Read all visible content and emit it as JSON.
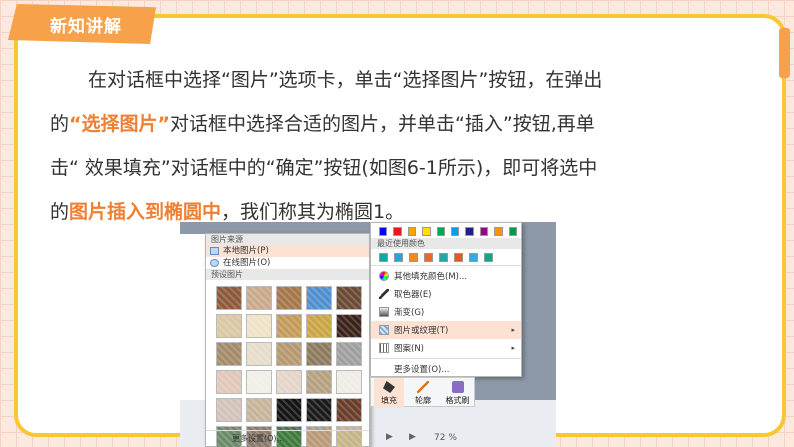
{
  "badge": {
    "label": "新知讲解"
  },
  "paragraph": {
    "l1": "在对话框中选择“图片”选项卡，单击“选择图片”按钮，在弹出",
    "l2_a": "的",
    "l2_hl": "“选择图片”",
    "l2_b": "对话框中选择合适的图片，并单击“插入”按钮,再单",
    "l3": "击“ 效果填充”对话框中的“确定”按钮(如图6-1所示)，即可将选中",
    "l4_a": "的",
    "l4_hl": "图片插入到椭圆中",
    "l4_b": "，我们称其为椭圆1。"
  },
  "picture_menu": {
    "source_header": "图片来源",
    "local": "本地图片(P)",
    "online": "在线图片(O)",
    "preset_header": "预设图片",
    "more": "更多设置(O)..."
  },
  "color_menu": {
    "recent_header": "最近使用颜色",
    "items": {
      "other_fill": "其他填充颜色(M)...",
      "eyedropper": "取色器(E)",
      "gradient": "渐变(G)",
      "picture_texture": "图片或纹理(T)",
      "pattern": "图案(N)",
      "more": "更多设置(O)..."
    }
  },
  "toolbar": {
    "fill": "填充",
    "outline": "轮廓",
    "format_painter": "格式刷"
  },
  "status": {
    "zoom": "72 %"
  },
  "colors": {
    "accent": "#f7a24a",
    "border": "#f9c731",
    "highlight": "#ef7f33",
    "theme_row": [
      "#0000ff",
      "#e61b1b",
      "#f7a600",
      "#ffde00",
      "#00a650",
      "#00a0e9",
      "#1d2088",
      "#920783",
      "#f39800",
      "#009944"
    ],
    "recent_row": [
      "#1aa3a6",
      "#29a3d6",
      "#ef8a22",
      "#e8692a",
      "#1fa7a9",
      "#e5572b",
      "#37a9e0",
      "#10a58a"
    ],
    "textures": [
      "#8c5a3b",
      "#c9a98a",
      "#a4764c",
      "#4f8fcf",
      "#6a4a34",
      "#d9c7a5",
      "#efe2c6",
      "#c49a5a",
      "#c9a545",
      "#3b2218",
      "#a38a6a",
      "#e6dcc9",
      "#b59770",
      "#8c7a5e",
      "#9f9f9f",
      "#e0c7b9",
      "#f2eee8",
      "#e3d6c8",
      "#b5a07f",
      "#f0ece4",
      "#d3c2b8",
      "#c7b59b",
      "#141414",
      "#1a1a1a",
      "#6a3c2a",
      "#6a8a6a",
      "#8a7a6a",
      "#3d7a3c",
      "#b89a78",
      "#c4b488"
    ]
  }
}
